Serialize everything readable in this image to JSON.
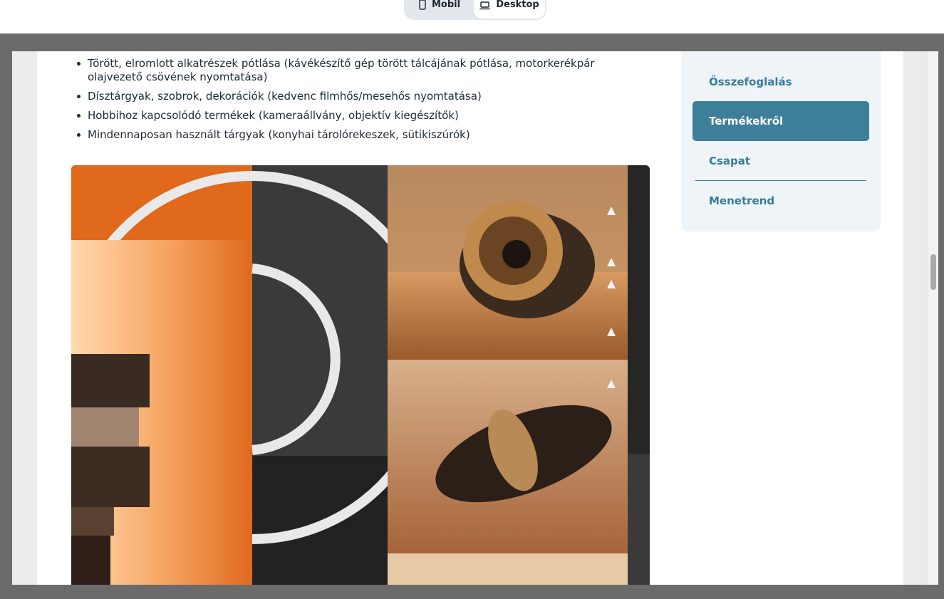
{
  "toolbar": {
    "mobil_label": "Mobil",
    "desktop_label": "Desktop",
    "mobil_icon": "phone-icon",
    "desktop_icon": "laptop-icon",
    "active": "Desktop"
  },
  "content": {
    "bullets": [
      "Törött, elromlott alkatrészek pótlása (kávékészítő gép törött tálcájának pótlása, motorkerékpár olajvezető csövének nyomtatása)",
      "Dísztárgyak, szobrok, dekorációk (kedvenc filmhős/mesehős nyomtatása)",
      "Hobbihoz kapcsolódó termékek (kameraállvány, objektív kiegészítők)",
      "Mindennaposan használt tárgyak (konyhai tárolórekeszek, sütikiszúrók)"
    ]
  },
  "toc": {
    "items": [
      {
        "label": "Összefoglalás",
        "active": false
      },
      {
        "label": "Termékekről",
        "active": true
      },
      {
        "label": "Csapat",
        "active": false
      },
      {
        "label": "Menetrend",
        "active": false
      }
    ]
  },
  "colors": {
    "accent": "#3d7e99",
    "toc_bg": "#eef4f7",
    "text": "#1e2a36"
  }
}
